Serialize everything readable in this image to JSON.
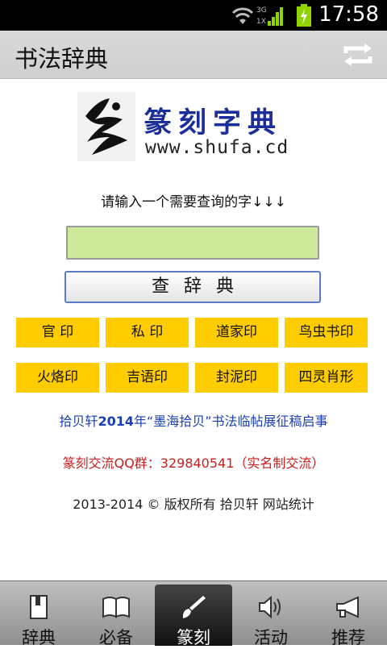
{
  "status_bar": {
    "time": "17:58",
    "net_label": "3G",
    "net_sub": "1X"
  },
  "header": {
    "title": "书法辞典",
    "refresh_icon": "refresh-icon"
  },
  "logo": {
    "title": "篆刻字典",
    "url": "www.shufa.cd"
  },
  "search": {
    "prompt": "请输入一个需要查询的字↓↓↓",
    "value": "",
    "button_label": "查辞典"
  },
  "categories": [
    "官 印",
    "私 印",
    "道家印",
    "鸟虫书印",
    "火烙印",
    "吉语印",
    "封泥印",
    "四灵肖形"
  ],
  "notice": {
    "part1": "拾贝轩",
    "part2": "2014",
    "part3": "年“墨海拾贝”书法临帖展征稿启事"
  },
  "qq": "篆刻交流QQ群：329840541（实名制交流）",
  "footer": "2013-2014 © 版权所有 拾贝轩  网站统计",
  "tabs": [
    {
      "label": "辞典",
      "icon": "book-icon",
      "active": false
    },
    {
      "label": "必备",
      "icon": "open-book-icon",
      "active": false
    },
    {
      "label": "篆刻",
      "icon": "brush-icon",
      "active": true
    },
    {
      "label": "活动",
      "icon": "speaker-icon",
      "active": false
    },
    {
      "label": "推荐",
      "icon": "megaphone-icon",
      "active": false
    }
  ],
  "colors": {
    "accent_yellow": "#ffcc00",
    "input_green": "#cfe99a",
    "link_blue": "#1a3fb5",
    "qq_red": "#c81e1e",
    "logo_blue": "#1c2e9a"
  }
}
